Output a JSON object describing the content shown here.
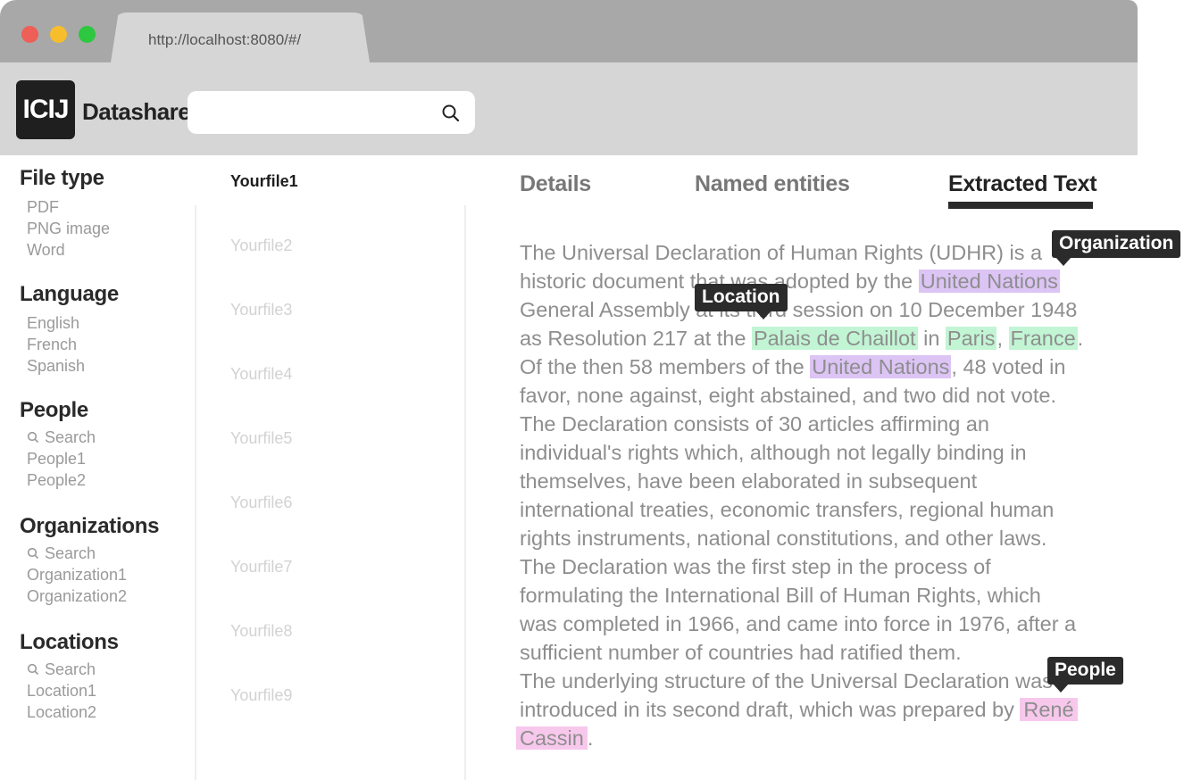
{
  "browser": {
    "url": "http://localhost:8080/#/"
  },
  "app": {
    "logo_text": "ICIJ",
    "name": "Datashare",
    "search_placeholder": "",
    "search_value": ""
  },
  "filters": {
    "file_type": {
      "title": "File type",
      "items": [
        "PDF",
        "PNG image",
        "Word"
      ]
    },
    "language": {
      "title": "Language",
      "items": [
        "English",
        "French",
        "Spanish"
      ]
    },
    "people": {
      "title": "People",
      "search": "Search",
      "items": [
        "People1",
        "People2"
      ]
    },
    "organizations": {
      "title": "Organizations",
      "search": "Search",
      "items": [
        "Organization1",
        "Organization2"
      ]
    },
    "locations": {
      "title": "Locations",
      "search": "Search",
      "items": [
        "Location1",
        "Location2"
      ]
    }
  },
  "files": [
    "Yourfile1",
    "Yourfile2",
    "Yourfile3",
    "Yourfile4",
    "Yourfile5",
    "Yourfile6",
    "Yourfile7",
    "Yourfile8",
    "Yourfile9"
  ],
  "tabs": [
    "Details",
    "Named entities",
    "Extracted Text"
  ],
  "active_tab": "Extracted Text",
  "tooltips": {
    "organization": "Organization",
    "location": "Location",
    "people": "People"
  },
  "text": {
    "l1": "The Universal Declaration of Human Rights (UDHR) is a",
    "l2a": "historic document that was adopted by the ",
    "l2_org": "United Nations",
    "l3": "General Assembly at its third session on 10 December 1948",
    "l4a": "as Resolution 217 at the ",
    "l4_loc1": "Palais de Chaillot",
    "l4b": " in ",
    "l4_loc2": "Paris",
    "l4c": ", ",
    "l4_loc3": "France",
    "l4d": ".",
    "l5a": "Of the then 58 members of the ",
    "l5_org": "United Nations",
    "l5b": ", 48 voted in",
    "l6": "favor, none against, eight abstained, and two did not vote.",
    "l7": "The Declaration consists of 30 articles affirming an",
    "l8": "individual's rights which, although not legally binding in",
    "l9": "themselves, have been elaborated in subsequent",
    "l10": "international treaties, economic transfers, regional human",
    "l11": "rights instruments, national constitutions, and other laws.",
    "l12": "The Declaration was the first step in the process of",
    "l13": "formulating the International Bill of Human Rights, which",
    "l14": "was completed in 1966, and came into force in 1976, after a",
    "l15": "sufficient number of countries had ratified them.",
    "l16": "The underlying structure of the Universal Declaration was",
    "l17a": "introduced in its second draft, which was prepared by ",
    "l17_per": "René",
    "l18_per": "Cassin",
    "l18b": "."
  },
  "colors": {
    "organization_highlight": "#dcc4f5",
    "location_highlight": "#c2f5d4",
    "people_highlight": "#f7c8ec",
    "tooltip_bg": "#2b2b2b"
  }
}
